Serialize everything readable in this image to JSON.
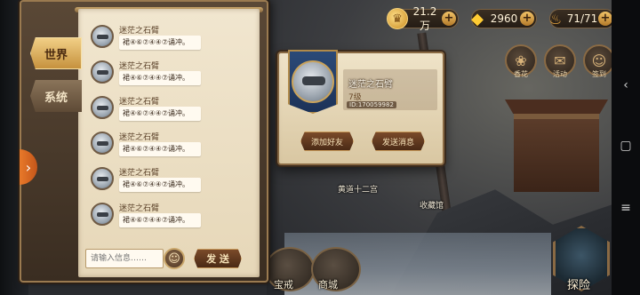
{
  "resources": {
    "gold": "21.2万",
    "gems": "2960",
    "stamina": "71/71"
  },
  "side_icons": [
    {
      "label": "香花",
      "icon": "flower-bag-icon"
    },
    {
      "label": "活动",
      "icon": "gift-box-icon"
    },
    {
      "label": "签到",
      "icon": "character-icon"
    }
  ],
  "chat": {
    "tabs": [
      {
        "label": "世界",
        "active": true
      },
      {
        "label": "系统",
        "active": false
      }
    ],
    "messages": [
      {
        "name": "迷茫之石臂",
        "text": "裙④⑥⑦④④⑦诵冲。"
      },
      {
        "name": "迷茫之石臂",
        "text": "裙④⑥⑦④④⑦诵冲。"
      },
      {
        "name": "迷茫之石臂",
        "text": "裙④⑥⑦④④⑦诵冲。"
      },
      {
        "name": "迷茫之石臂",
        "text": "裙④⑥⑦④④⑦诵冲。"
      },
      {
        "name": "迷茫之石臂",
        "text": "裙④⑥⑦④④⑦诵冲。"
      },
      {
        "name": "迷茫之石臂",
        "text": "裙④⑥⑦④④⑦诵冲。"
      }
    ],
    "input_placeholder": "请输入信息……",
    "send_label": "发 送"
  },
  "friend_card": {
    "name": "迷茫之石臂",
    "level": "7级",
    "uid": "ID:170059982",
    "add_friend_label": "添加好友",
    "send_message_label": "发送消息"
  },
  "map": {
    "label_a": "黄道十二宫",
    "label_b": "收藏馆"
  },
  "bottom_nav": {
    "item1": "宝戒",
    "item2": "商城",
    "explore": "探险"
  },
  "colors": {
    "accent_gold": "#f1cf86",
    "panel_bg": "#f1e6cf",
    "arrow_orange": "#e8792a"
  }
}
